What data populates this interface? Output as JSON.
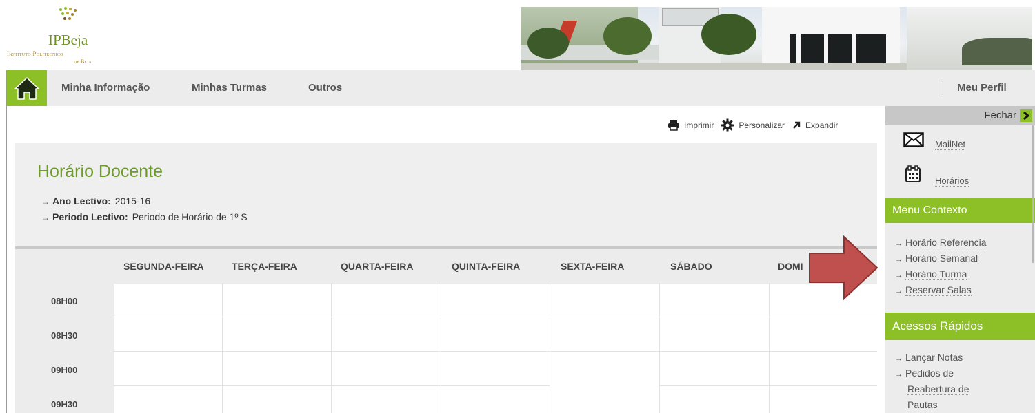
{
  "header": {
    "logo_name": "IPBeja",
    "logo_sub1": "Instituto Politécnico",
    "logo_sub2": "de Beja"
  },
  "nav": {
    "items": [
      "Minha Informação",
      "Minhas Turmas",
      "Outros"
    ],
    "profile": "Meu Perfil"
  },
  "toolbar": {
    "print": "Imprimir",
    "customize": "Personalizar",
    "expand": "Expandir"
  },
  "page": {
    "title": "Horário Docente",
    "ano_label": "Ano Lectivo:",
    "ano_value": "2015-16",
    "periodo_label": "Periodo Lectivo:",
    "periodo_value": "Periodo de Horário de 1º S"
  },
  "schedule": {
    "days": [
      "SEGUNDA-FEIRA",
      "TERÇA-FEIRA",
      "QUARTA-FEIRA",
      "QUINTA-FEIRA",
      "SEXTA-FEIRA",
      "SÁBADO",
      "DOMI"
    ],
    "times": [
      "08H00",
      "08H30",
      "09H00",
      "09H30"
    ]
  },
  "sidebar": {
    "close": "Fechar",
    "mailnet": "MailNet",
    "horarios": "Horários",
    "context_title": "Menu Contexto",
    "context_items": [
      "Horário Referencia",
      "Horário Semanal",
      "Horário Turma",
      "Reservar Salas"
    ],
    "quick_title": "Acessos Rápidos",
    "quick_items": [
      "Lançar Notas",
      "Pedidos de"
    ],
    "quick_continuation": [
      "Reabertura de",
      "Pautas"
    ]
  },
  "colors": {
    "accent_green": "#8dc026",
    "title_green": "#6e9a2a",
    "arrow_red": "#c0504d"
  }
}
